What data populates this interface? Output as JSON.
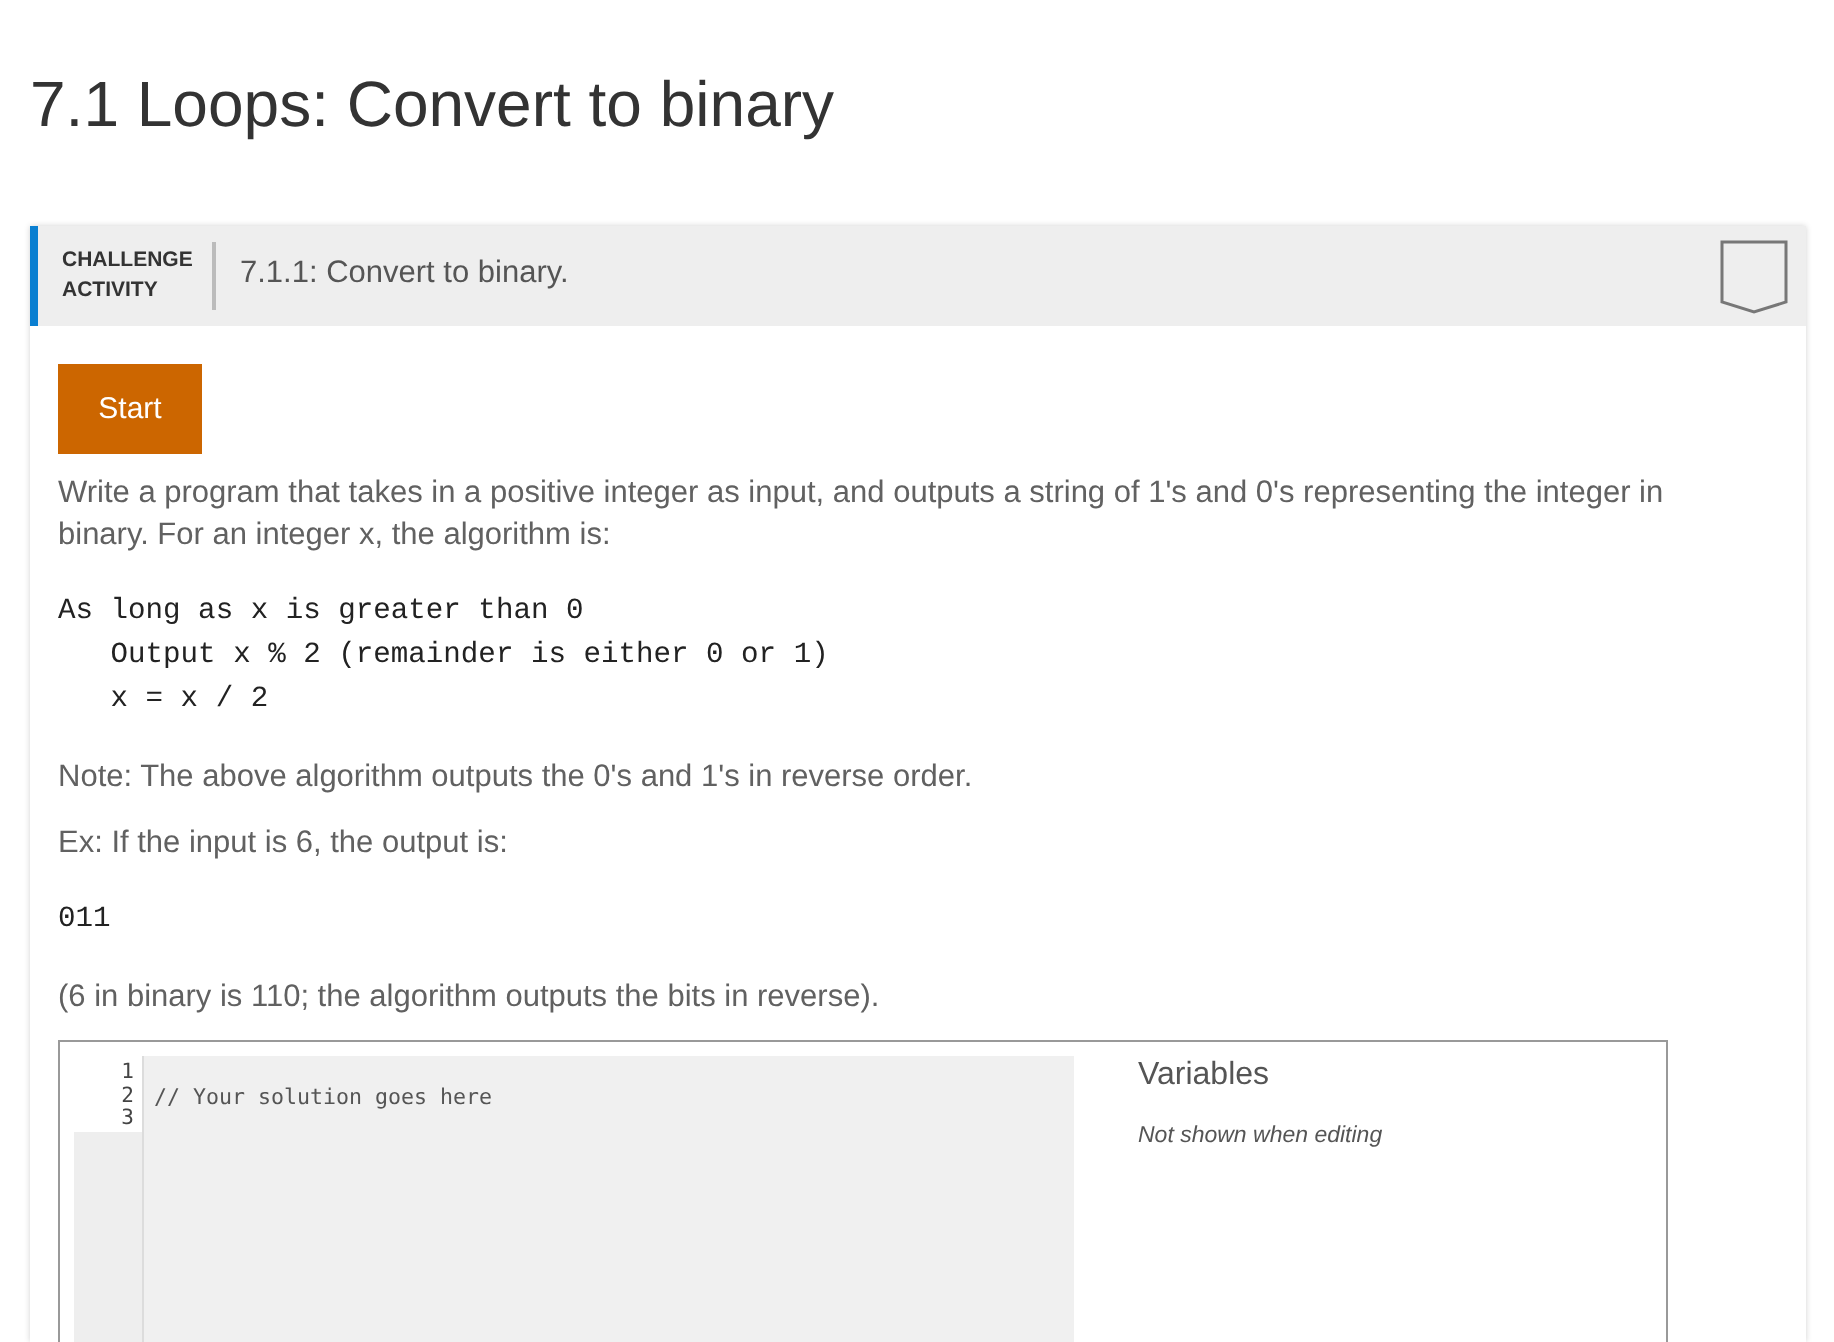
{
  "page_title": "7.1 Loops: Convert to binary",
  "activity": {
    "type_label": "CHALLENGE ACTIVITY",
    "title": "7.1.1: Convert to binary.",
    "completed": false
  },
  "start_button": "Start",
  "content": [
    {
      "kind": "paragraph",
      "text": "Write a program that takes in a positive integer as input, and outputs a string of 1's and 0's representing the integer in binary. For an integer x, the algorithm is:"
    },
    {
      "kind": "code",
      "text": "As long as x is greater than 0\n   Output x % 2 (remainder is either 0 or 1)\n   x = x / 2"
    },
    {
      "kind": "paragraph",
      "text": "Note: The above algorithm outputs the 0's and 1's in reverse order."
    },
    {
      "kind": "paragraph",
      "text": "Ex: If the input is 6, the output is:"
    },
    {
      "kind": "code",
      "text": "011"
    },
    {
      "kind": "paragraph",
      "text": "(6 in binary is 110; the algorithm outputs the bits in reverse)."
    }
  ],
  "editor": {
    "lines": [
      {
        "number": "1"
      },
      {
        "number": "2",
        "code": "// Your solution goes here"
      },
      {
        "number": "3"
      }
    ]
  },
  "variables": {
    "heading": "Variables",
    "note": "Not shown when editing"
  }
}
